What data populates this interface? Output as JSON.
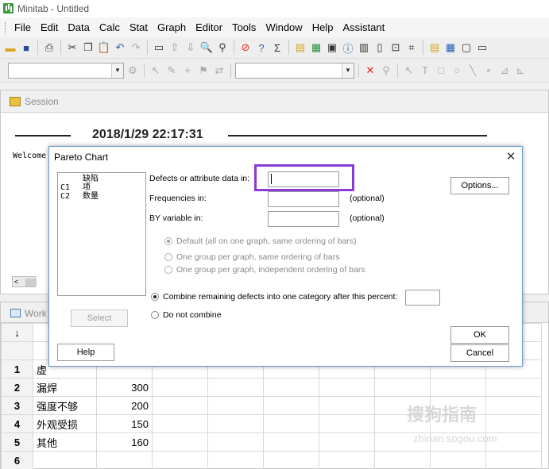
{
  "window": {
    "title": "Minitab - Untitled"
  },
  "menu": [
    "File",
    "Edit",
    "Data",
    "Calc",
    "Stat",
    "Graph",
    "Editor",
    "Tools",
    "Window",
    "Help",
    "Assistant"
  ],
  "session": {
    "title": "Session",
    "timestamp": "2018/1/29 22:17:31",
    "welcome": "Welcome"
  },
  "worksheet": {
    "title": "Work",
    "rows": [
      {
        "n": "1",
        "c1": "虚",
        "c2": ""
      },
      {
        "n": "2",
        "c1": "漏焊",
        "c2": "300"
      },
      {
        "n": "3",
        "c1": "强度不够",
        "c2": "200"
      },
      {
        "n": "4",
        "c1": "外观受损",
        "c2": "150"
      },
      {
        "n": "5",
        "c1": "其他",
        "c2": "160"
      },
      {
        "n": "6",
        "c1": "",
        "c2": ""
      }
    ]
  },
  "dialog": {
    "title": "Pareto Chart",
    "variables": [
      {
        "col": "C1",
        "name": "缺陷项"
      },
      {
        "col": "C2",
        "name": "数量"
      }
    ],
    "defects_label": "Defects or attribute data in:",
    "defects_value": "",
    "frequencies_label": "Frequencies in:",
    "frequencies_value": "",
    "by_label": "BY variable in:",
    "by_value": "",
    "optional": "(optional)",
    "options_button": "Options...",
    "graph_options": [
      "Default (all on one graph, same ordering of bars)",
      "One group per graph, same ordering of bars",
      "One group per graph, independent ordering of bars"
    ],
    "combine_label": "Combine remaining defects into one category after this percent:",
    "combine_value": "",
    "no_combine_label": "Do not combine",
    "select_button": "Select",
    "help_button": "Help",
    "ok_button": "OK",
    "cancel_button": "Cancel"
  },
  "watermark": {
    "main": "搜狗指南",
    "sub": "zhinan.sogou.com"
  },
  "colors": {
    "highlight": "#8a3ad6",
    "dialog_border": "#6a9bd0"
  }
}
